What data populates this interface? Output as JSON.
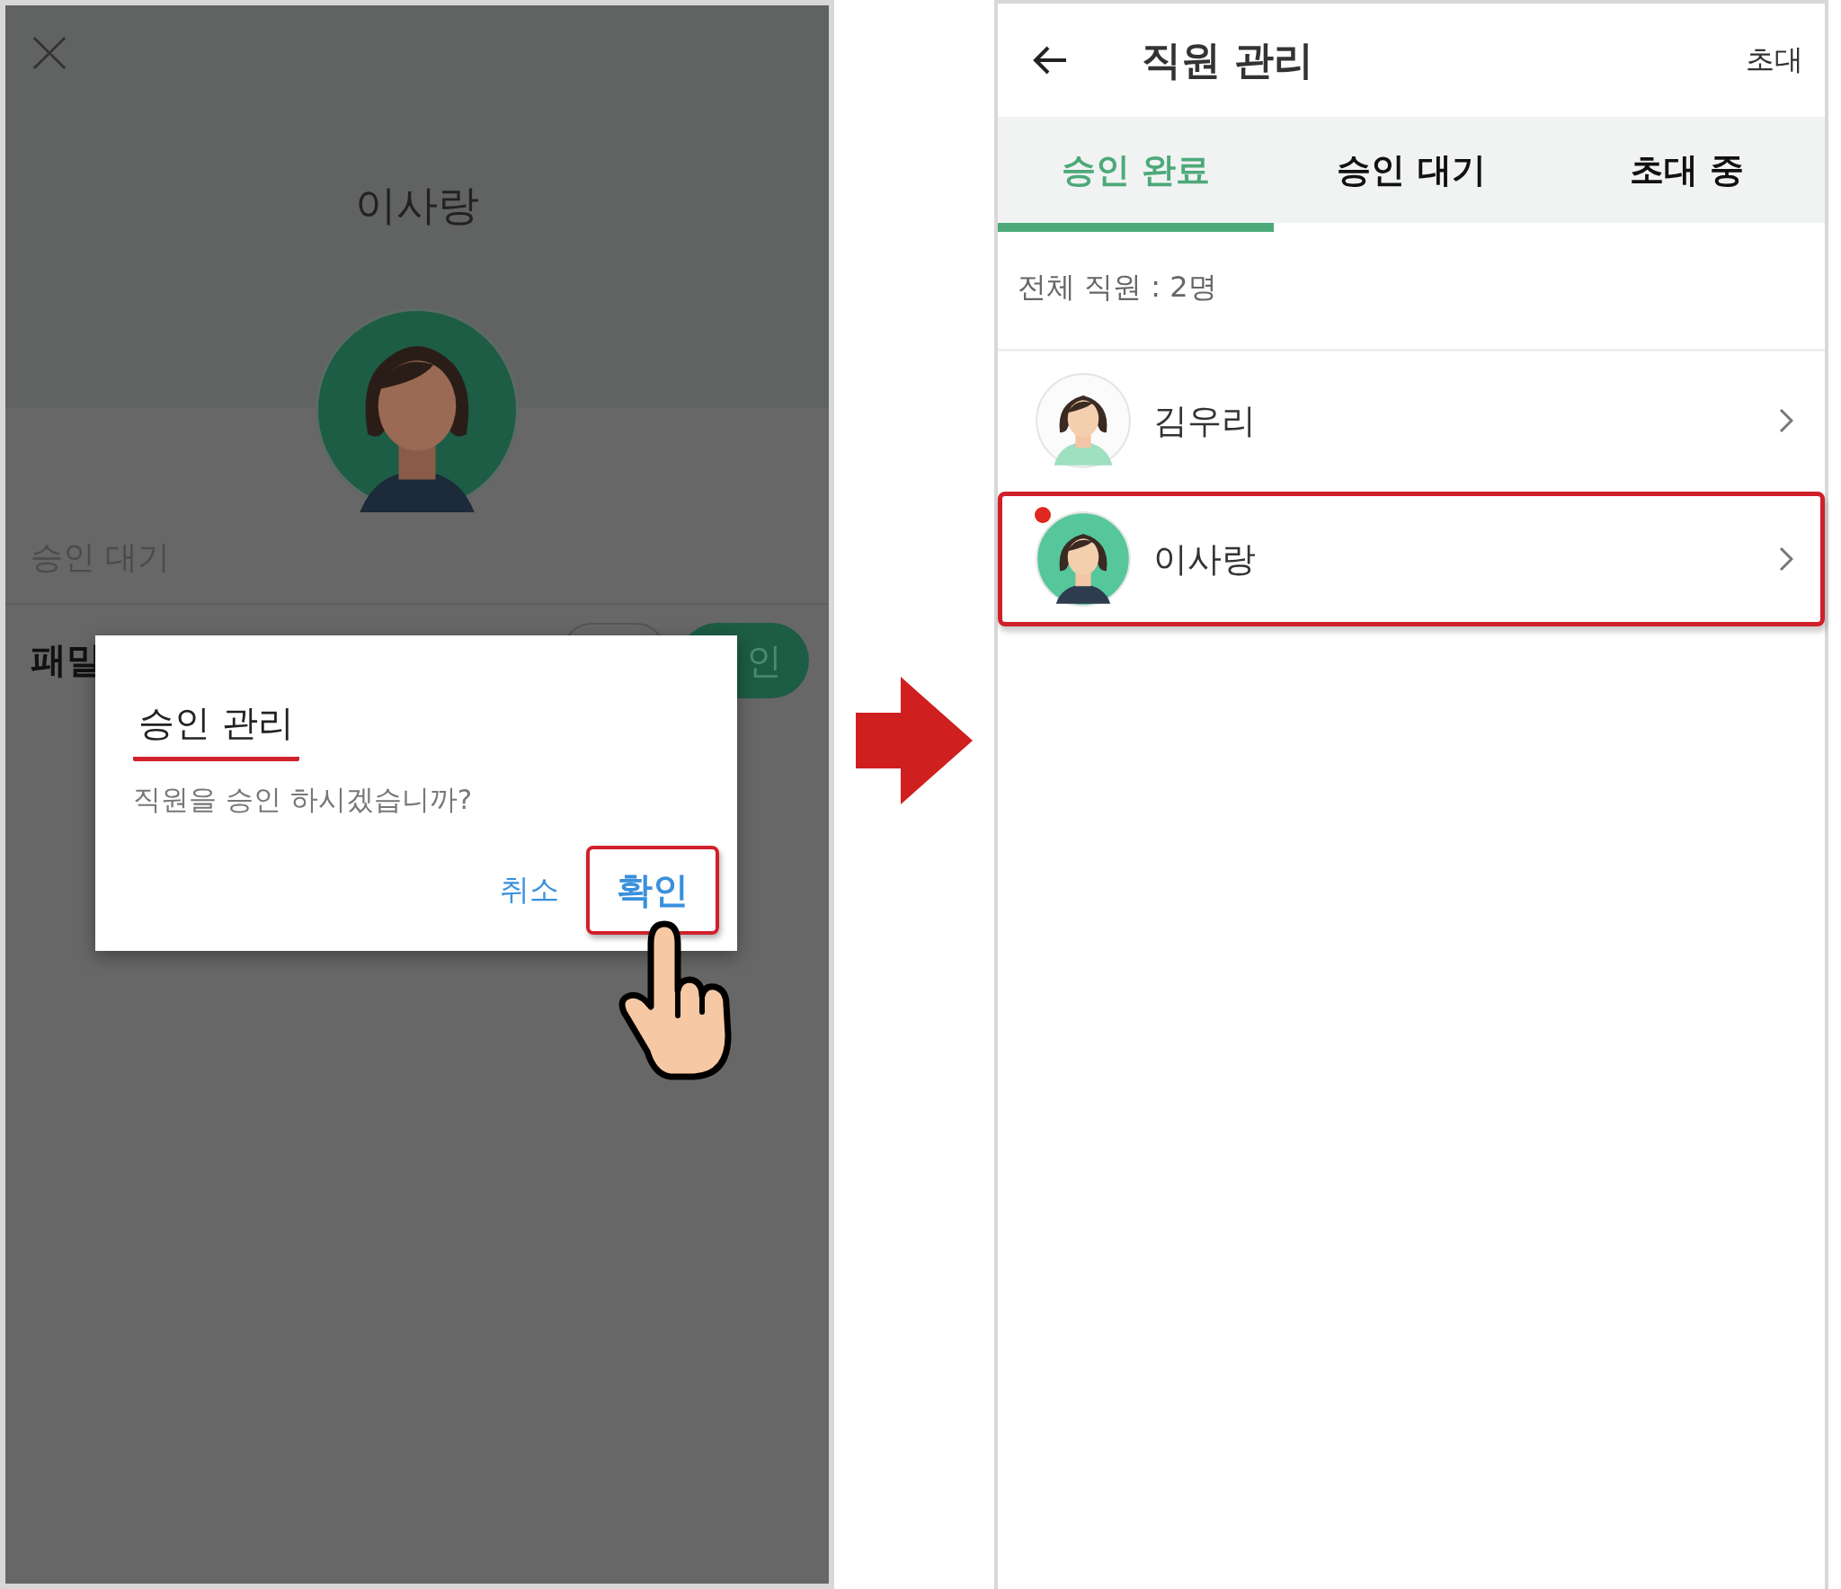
{
  "approval_screen": {
    "name": "이사랑",
    "section_label": "승인 대기",
    "row_label": "패밀",
    "row_button": "인"
  },
  "dialog": {
    "title": "승인 관리",
    "title_underlined": true,
    "message": "직원을 승인 하시겠습니까?",
    "buttons": [
      {
        "label": "취소",
        "highlighted": false
      },
      {
        "label": "확인",
        "highlighted": true
      }
    ]
  },
  "staff_screen": {
    "title": "직원 관리",
    "action": "초대",
    "tabs": [
      {
        "label": "승인 완료",
        "selected": true
      },
      {
        "label": "승인 대기",
        "selected": false
      },
      {
        "label": "초대 중",
        "selected": false
      }
    ],
    "count": "전체 직원 : 2명",
    "staff": [
      {
        "name": "김우리",
        "kind": "uniform",
        "highlighted": false,
        "new": false
      },
      {
        "name": "이사랑",
        "kind": "green",
        "highlighted": true,
        "new": true
      }
    ]
  }
}
